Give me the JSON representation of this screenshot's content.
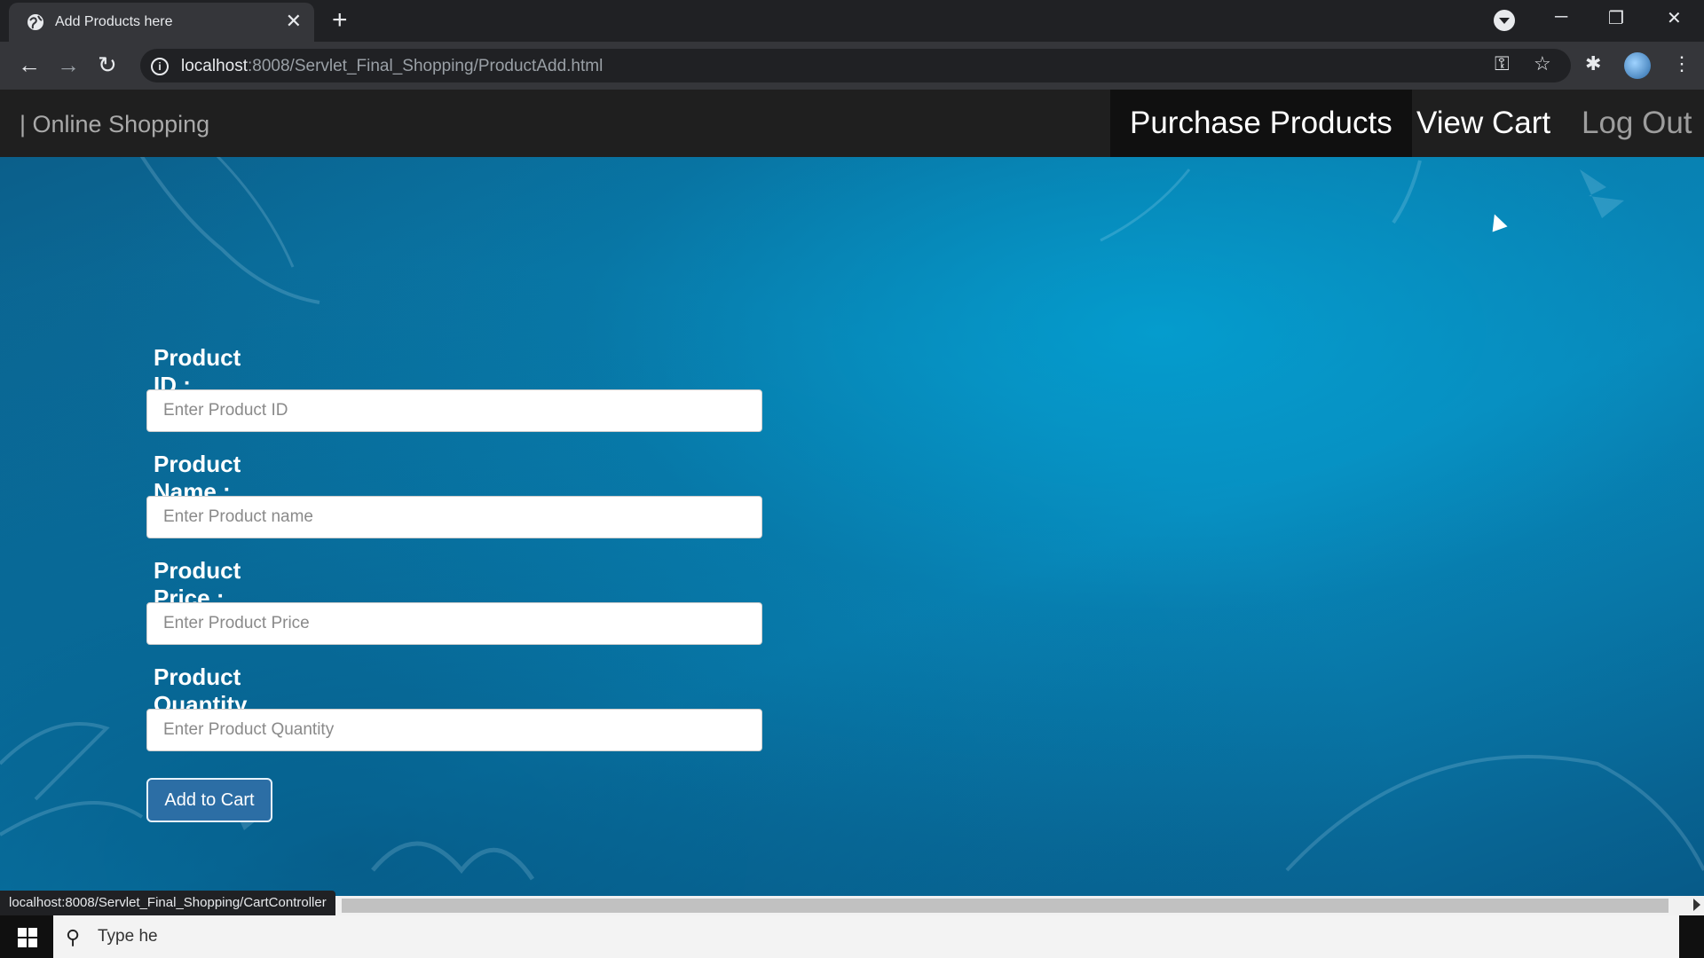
{
  "browser": {
    "tab_title": "Add Products here",
    "url_host": "localhost",
    "url_rest": ":8008/Servlet_Final_Shopping/ProductAdd.html",
    "status_url": "localhost:8008/Servlet_Final_Shopping/CartController"
  },
  "navbar": {
    "brand": "| Online Shopping",
    "items": [
      {
        "label": "Purchase Products"
      },
      {
        "label": "View Cart"
      },
      {
        "label": "Log Out"
      }
    ]
  },
  "form": {
    "product_id": {
      "label": "Product ID :",
      "placeholder": "Enter Product ID"
    },
    "product_name": {
      "label": "Product Name :",
      "placeholder": "Enter Product name"
    },
    "product_price": {
      "label": "Product Price :",
      "placeholder": "Enter Product Price"
    },
    "product_quantity": {
      "label": "Product Quantity :",
      "placeholder": "Enter Product Quantity"
    },
    "submit_label": "Add to Cart"
  },
  "taskbar": {
    "search_text": "Type he"
  },
  "colors": {
    "page_accent": "#0a86b8",
    "navbar_bg": "#1f1f1f",
    "button_bg": "#2c6ea5"
  }
}
